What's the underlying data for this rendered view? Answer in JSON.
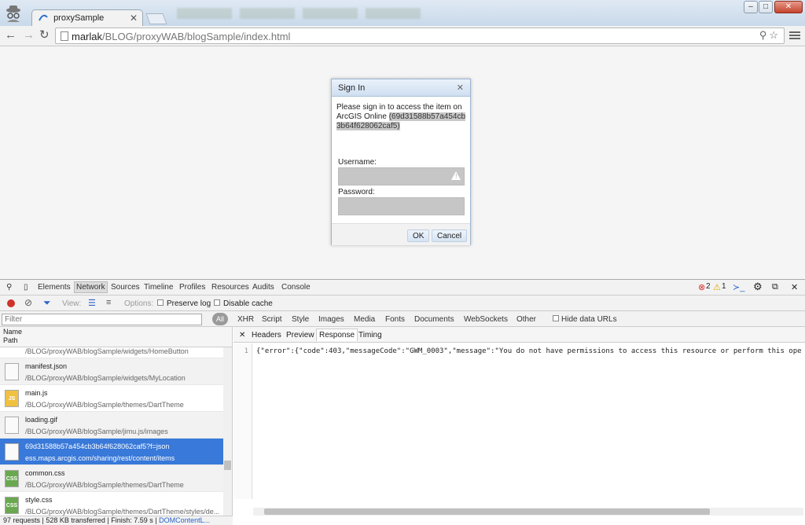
{
  "browser": {
    "tab_title": "proxySample",
    "url_host": "marlak",
    "url_path": "/BLOG/proxyWAB/blogSample/index.html"
  },
  "dialog": {
    "title": "Sign In",
    "message": "Please sign in to access the item on ArcGIS Online",
    "item_id": "(69d31588b57a454cb3b64f628062caf5)",
    "username_label": "Username:",
    "password_label": "Password:",
    "ok_label": "OK",
    "cancel_label": "Cancel"
  },
  "devtools": {
    "tabs": [
      "Elements",
      "Network",
      "Sources",
      "Timeline",
      "Profiles",
      "Resources",
      "Audits",
      "Console"
    ],
    "error_count": "2",
    "warning_count": "1",
    "view_label": "View:",
    "options_label": "Options:",
    "preserve_log_label": "Preserve log",
    "disable_cache_label": "Disable cache",
    "filter_placeholder": "Filter",
    "all_label": "All",
    "filter_types": [
      "XHR",
      "Script",
      "Style",
      "Images",
      "Media",
      "Fonts",
      "Documents",
      "WebSockets",
      "Other"
    ],
    "hide_data_urls_label": "Hide data URLs",
    "col_name": "Name",
    "col_path": "Path",
    "requests": [
      {
        "name": "",
        "path": "/BLOG/proxyWAB/blogSample/widgets/HomeButton",
        "icon": "file"
      },
      {
        "name": "manifest.json",
        "path": "/BLOG/proxyWAB/blogSample/widgets/MyLocation",
        "icon": "file"
      },
      {
        "name": "main.js",
        "path": "/BLOG/proxyWAB/blogSample/themes/DartTheme",
        "icon": "JS"
      },
      {
        "name": "loading.gif",
        "path": "/BLOG/proxyWAB/blogSample/jimu.js/images",
        "icon": "image"
      },
      {
        "name": "69d31588b57a454cb3b64f628062caf5?f=json",
        "path": "ess.maps.arcgis.com/sharing/rest/content/items",
        "icon": "file"
      },
      {
        "name": "common.css",
        "path": "/BLOG/proxyWAB/blogSample/themes/DartTheme",
        "icon": "CSS"
      },
      {
        "name": "style.css",
        "path": "/BLOG/proxyWAB/blogSample/themes/DartTheme/styles/de...",
        "icon": "CSS"
      }
    ],
    "detail_tabs": [
      "Headers",
      "Preview",
      "Response",
      "Timing"
    ],
    "active_detail_tab": "Response",
    "response_line_no": "1",
    "response_text": "{\"error\":{\"code\":403,\"messageCode\":\"GWM_0003\",\"message\":\"You do not have permissions to access this resource or perform this ope",
    "status": {
      "requests": "97 requests",
      "transferred": "528 KB transferred",
      "finish": "Finish: 7.59 s",
      "dcl": "DOMContentL..."
    }
  },
  "colors": {
    "selected_row": "#3879d9",
    "record_button": "#d0322a",
    "dialog_header": "#cfdff1"
  }
}
